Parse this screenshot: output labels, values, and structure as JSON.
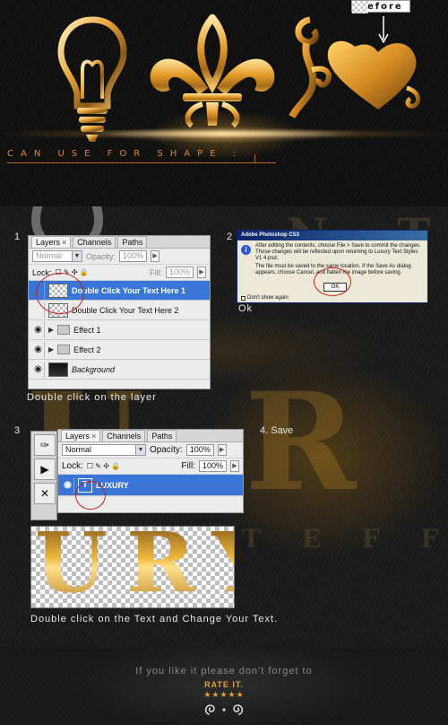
{
  "hero": {
    "before_label": "Before",
    "shapes_caption": "CAN USE FOR SHAPE :",
    "shape_icons": [
      "lightbulb-icon",
      "fleur-de-lis-icon",
      "heart-swirl-icon"
    ],
    "accent_color": "#e0842e"
  },
  "background_words": {
    "top": "N T",
    "big": "U R",
    "bottom": "T E F F"
  },
  "step1": {
    "number": "1",
    "tabs": [
      {
        "label": "Layers",
        "close": "×"
      },
      {
        "label": "Channels"
      },
      {
        "label": "Paths"
      }
    ],
    "blend_mode": "Normal",
    "opacity_label": "Opacity:",
    "opacity_value": "100%",
    "lock_label": "Lock:",
    "fill_label": "Fill:",
    "fill_value": "100%",
    "layers": [
      {
        "name": "Double Click Your Text Here 1",
        "selected": true
      },
      {
        "name": "Double Click Your Text Here 2",
        "selected": false
      },
      {
        "name": "Effect 1",
        "selected": false
      },
      {
        "name": "Effect 2",
        "selected": false
      },
      {
        "name": "Background",
        "selected": false
      }
    ],
    "caption": "Double click on the layer"
  },
  "step2": {
    "number": "2",
    "dialog_title": "Adobe Photoshop CS3",
    "dialog_message": "After editing the contents, choose File > Save to commit the changes. Those changes will be reflected upon returning to Luxury Text Styles V1 4.psd.",
    "dialog_message2": "The file must be saved to the same location. If the Save As dialog appears, choose Cancel, and flatten the image before saving.",
    "ok_label": "OK",
    "dont_show_label": "Don't show again",
    "caption": "Ok"
  },
  "step3": {
    "number": "3",
    "tabs": [
      {
        "label": "Layers",
        "close": "×"
      },
      {
        "label": "Channels"
      },
      {
        "label": "Paths"
      }
    ],
    "blend_mode": "Normal",
    "opacity_label": "Opacity:",
    "opacity_value": "100%",
    "lock_label": "Lock:",
    "fill_label": "Fill:",
    "fill_value": "100%",
    "layer_name": "LUXURY",
    "layer_thumb": "T",
    "preview_text": "URY",
    "caption": "Double click on the Text and Change Your Text."
  },
  "step4": {
    "label": "4. Save"
  },
  "footer": {
    "message": "If you like it please don't forget to",
    "rate": "RATE IT.",
    "stars": "★★★★★"
  }
}
